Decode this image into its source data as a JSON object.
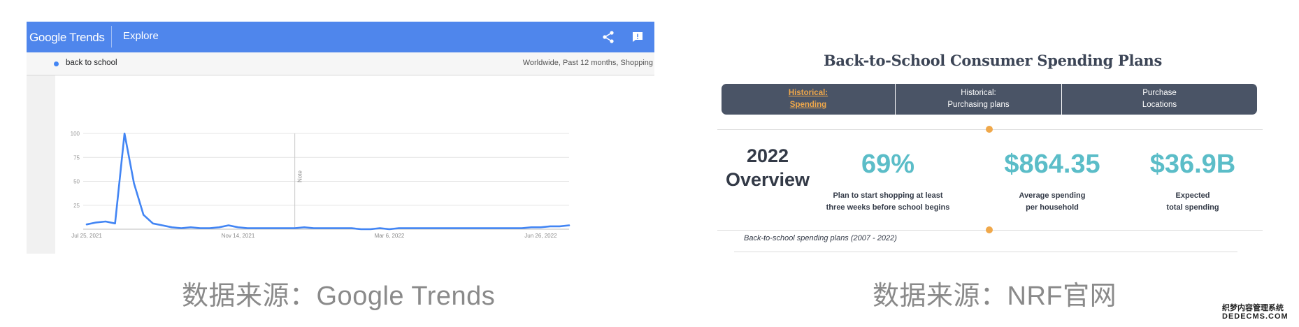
{
  "trends": {
    "logo": "Google Trends",
    "nav_title": "Explore",
    "search_term": "back to school",
    "filters": "Worldwide, Past 12 months, Shopping",
    "icons": {
      "share": "share-icon",
      "feedback": "feedback-icon"
    },
    "accent_color": "#4f86ec",
    "note_label": "Note"
  },
  "chart_data": {
    "type": "line",
    "title": "",
    "xlabel": "",
    "ylabel": "",
    "ylim": [
      0,
      100
    ],
    "yticks": [
      25,
      50,
      75,
      100
    ],
    "x_tick_labels": [
      "Jul 25, 2021",
      "Nov 14, 2021",
      "Mar 6, 2022",
      "Jun 26, 2022"
    ],
    "x_tick_index": [
      0,
      16,
      32,
      48
    ],
    "note_index": 22,
    "grid": true,
    "series": [
      {
        "name": "back to school",
        "color": "#4285f4",
        "values": [
          5,
          7,
          8,
          6,
          100,
          48,
          15,
          6,
          4,
          2,
          1,
          2,
          1,
          1,
          2,
          4,
          2,
          1,
          1,
          1,
          1,
          1,
          1,
          2,
          1,
          1,
          1,
          1,
          1,
          0,
          0,
          1,
          0,
          1,
          1,
          1,
          1,
          1,
          1,
          1,
          1,
          1,
          1,
          1,
          1,
          1,
          1,
          2,
          2,
          3,
          3,
          4
        ]
      }
    ]
  },
  "nrf": {
    "title": "Back-to-School Consumer Spending Plans",
    "tabs": [
      {
        "line1": "Historical:",
        "line2": "Spending"
      },
      {
        "line1": "Historical:",
        "line2": "Purchasing plans"
      },
      {
        "line1": "Purchase",
        "line2": "Locations"
      }
    ],
    "overview_line1": "2022",
    "overview_line2": "Overview",
    "stats": [
      {
        "value": "69%",
        "label1": "Plan to start shopping at least",
        "label2": "three weeks before school begins"
      },
      {
        "value": "$864.35",
        "label1": "Average spending",
        "label2": "per household"
      },
      {
        "value": "$36.9B",
        "label1": "Expected",
        "label2": "total spending"
      }
    ],
    "footnote": "Back-to-school spending plans (2007 - 2022)",
    "accent_color": "#5bbdc8",
    "highlight_color": "#f0a84a"
  },
  "captions": {
    "left": "数据来源：Google Trends",
    "right": "数据来源：NRF官网"
  },
  "watermark": {
    "line1": "织梦内容管理系统",
    "line2": "DEDECMS.COM"
  }
}
